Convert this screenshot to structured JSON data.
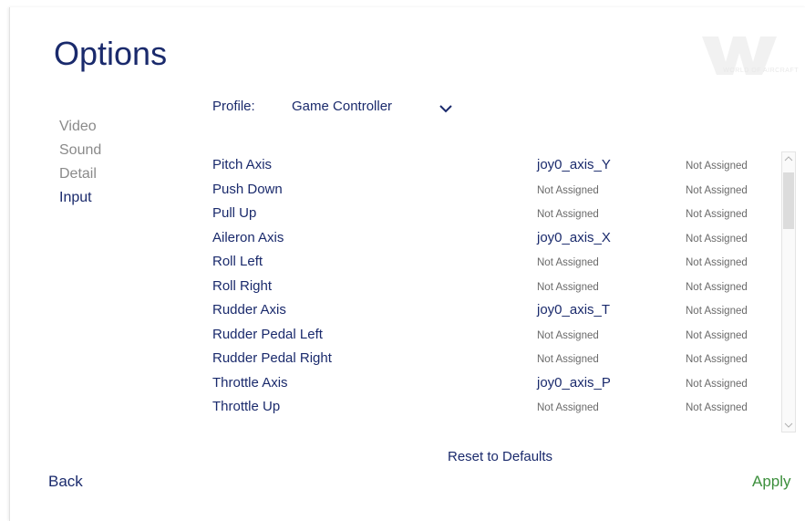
{
  "title": "Options",
  "logo": {
    "text": "WORLD OF AIRCRAFT"
  },
  "nav": [
    {
      "label": "Video"
    },
    {
      "label": "Sound"
    },
    {
      "label": "Detail"
    },
    {
      "label": "Input",
      "active": true
    }
  ],
  "profile": {
    "label": "Profile:",
    "value": "Game Controller"
  },
  "bindings": [
    {
      "action": "Pitch Axis",
      "primary": "joy0_axis_Y",
      "secondary": "Not Assigned"
    },
    {
      "action": "Push Down",
      "primary": "Not Assigned",
      "secondary": "Not Assigned"
    },
    {
      "action": "Pull Up",
      "primary": "Not Assigned",
      "secondary": "Not Assigned"
    },
    {
      "action": "Aileron Axis",
      "primary": "joy0_axis_X",
      "secondary": "Not Assigned"
    },
    {
      "action": "Roll Left",
      "primary": "Not Assigned",
      "secondary": "Not Assigned"
    },
    {
      "action": "Roll Right",
      "primary": "Not Assigned",
      "secondary": "Not Assigned"
    },
    {
      "action": "Rudder Axis",
      "primary": "joy0_axis_T",
      "secondary": "Not Assigned"
    },
    {
      "action": "Rudder Pedal Left",
      "primary": "Not Assigned",
      "secondary": "Not Assigned"
    },
    {
      "action": "Rudder Pedal Right",
      "primary": "Not Assigned",
      "secondary": "Not Assigned"
    },
    {
      "action": "Throttle Axis",
      "primary": "joy0_axis_P",
      "secondary": "Not Assigned"
    },
    {
      "action": "Throttle Up",
      "primary": "Not Assigned",
      "secondary": "Not Assigned"
    }
  ],
  "buttons": {
    "reset": "Reset to Defaults",
    "back": "Back",
    "apply": "Apply"
  },
  "colors": {
    "accent": "#1a2a6c",
    "muted": "#8a8a8a",
    "apply": "#3c8f3c"
  },
  "icons": {
    "dropdown": "chevron-down-icon",
    "scroll_up": "chevron-up-icon",
    "scroll_down": "chevron-down-icon"
  }
}
